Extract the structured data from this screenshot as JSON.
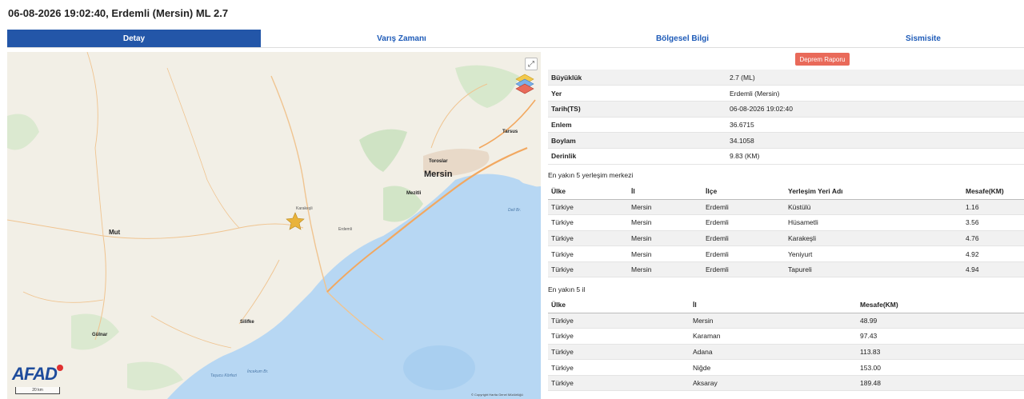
{
  "header": {
    "title": "06-08-2026 19:02:40, Erdemli (Mersin) ML 2.7"
  },
  "tabs": [
    "Detay",
    "Varış Zamanı",
    "Bölgesel Bilgi",
    "Sismisite"
  ],
  "map": {
    "labels": {
      "mersin": "Mersin",
      "mut": "Mut",
      "tarsus": "Tarsus",
      "toroslar": "Toroslar",
      "mezitli": "Mezitli",
      "silifke": "Silifke",
      "gulnar": "Gülnar",
      "deli_br": "Deli Br.",
      "tasucu": "Taşucu Körfezi",
      "incekum": "İncekum Br.",
      "yeniyurt": "Karakeşli",
      "erdemli": "Erdemli"
    },
    "scale": "20 km",
    "attribution": "© Copyright Harita Genel Müdürlüğü",
    "logo": "AFAD",
    "expand_icon": "expand-icon",
    "layers_icon": "layers-icon",
    "marker_icon": "star-icon"
  },
  "report_button": "Deprem Raporu",
  "details": [
    {
      "key": "Büyüklük",
      "value": "2.7 (ML)"
    },
    {
      "key": "Yer",
      "value": "Erdemli (Mersin)"
    },
    {
      "key": "Tarih(TS)",
      "value": "06-08-2026 19:02:40"
    },
    {
      "key": "Enlem",
      "value": "36.6715"
    },
    {
      "key": "Boylam",
      "value": "34.1058"
    },
    {
      "key": "Derinlik",
      "value": "9.83 (KM)"
    }
  ],
  "settlements": {
    "title": "En yakın 5 yerleşim merkezi",
    "columns": [
      "Ülke",
      "İl",
      "İlçe",
      "Yerleşim Yeri Adı",
      "Mesafe(KM)"
    ],
    "rows": [
      [
        "Türkiye",
        "Mersin",
        "Erdemli",
        "Küstülü",
        "1.16"
      ],
      [
        "Türkiye",
        "Mersin",
        "Erdemli",
        "Hüsametli",
        "3.56"
      ],
      [
        "Türkiye",
        "Mersin",
        "Erdemli",
        "Karakeşli",
        "4.76"
      ],
      [
        "Türkiye",
        "Mersin",
        "Erdemli",
        "Yeniyurt",
        "4.92"
      ],
      [
        "Türkiye",
        "Mersin",
        "Erdemli",
        "Tapureli",
        "4.94"
      ]
    ]
  },
  "provinces": {
    "title": "En yakın 5 il",
    "columns": [
      "Ülke",
      "İl",
      "Mesafe(KM)"
    ],
    "rows": [
      [
        "Türkiye",
        "Mersin",
        "48.99"
      ],
      [
        "Türkiye",
        "Karaman",
        "97.43"
      ],
      [
        "Türkiye",
        "Adana",
        "113.83"
      ],
      [
        "Türkiye",
        "Niğde",
        "153.00"
      ],
      [
        "Türkiye",
        "Aksaray",
        "189.48"
      ]
    ]
  }
}
